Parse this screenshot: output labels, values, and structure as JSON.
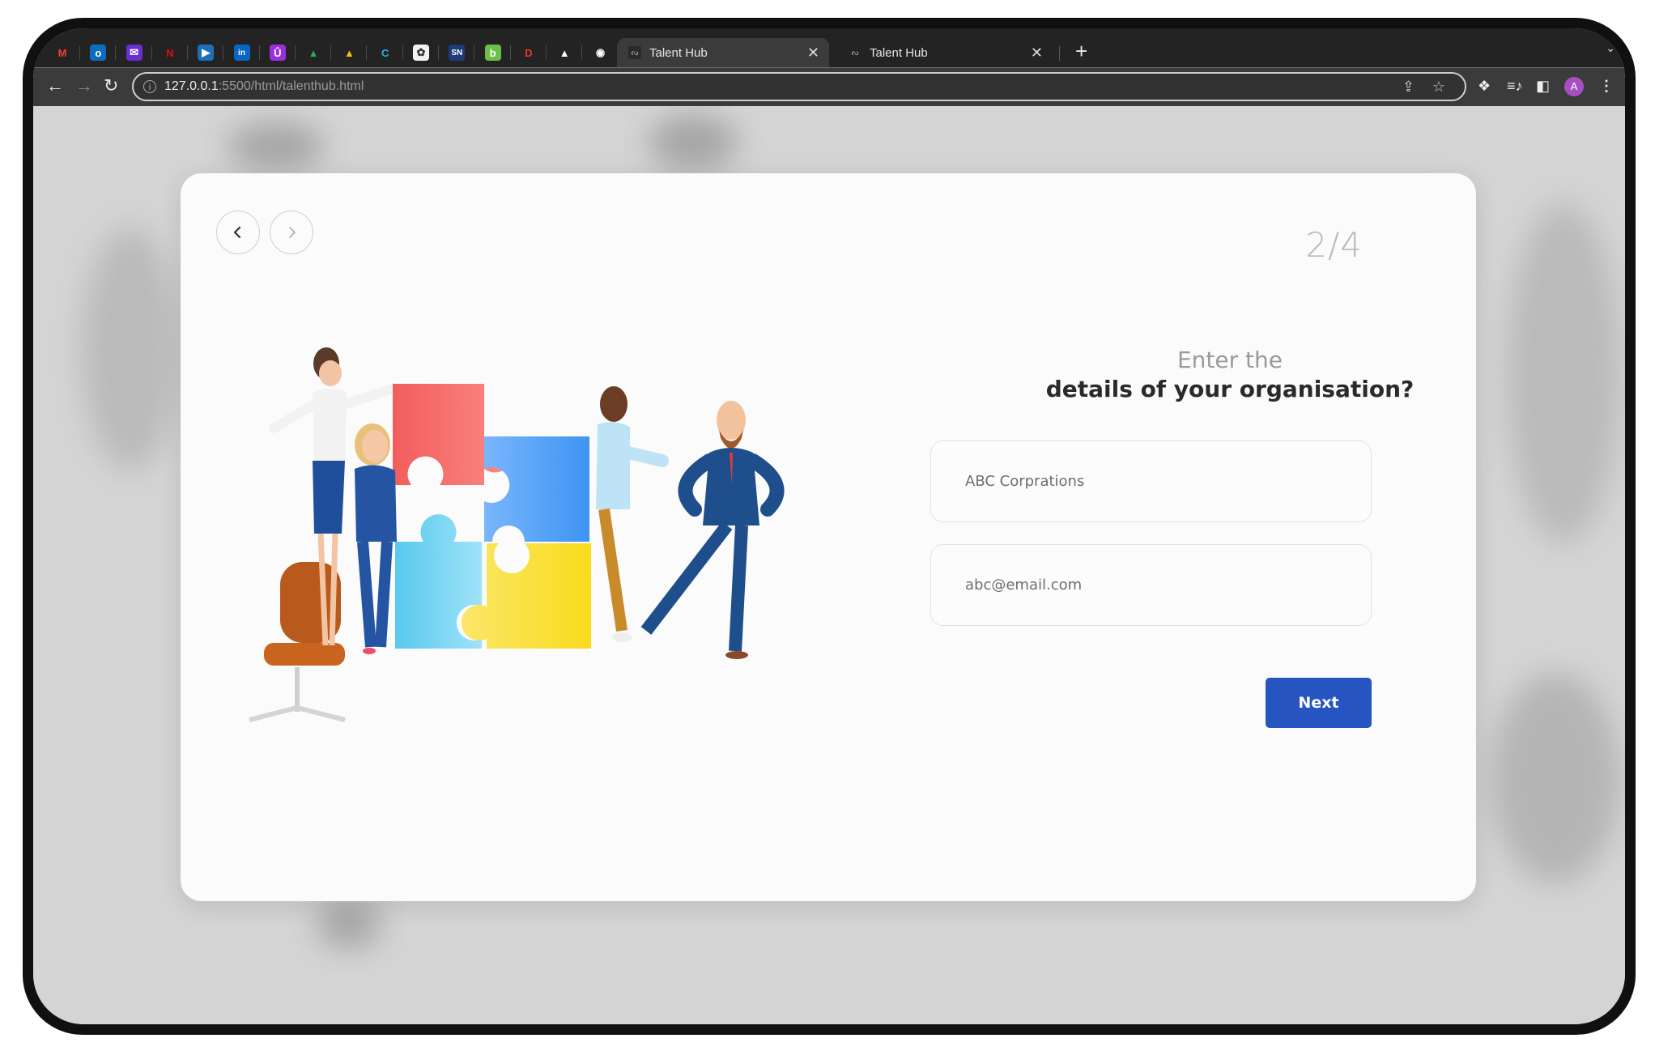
{
  "browser": {
    "pinned_tabs": [
      {
        "name": "gmail",
        "glyph": "M",
        "fg": "#ea4335",
        "bg": "transparent"
      },
      {
        "name": "outlook",
        "glyph": "o",
        "fg": "#ffffff",
        "bg": "#0f6cbd"
      },
      {
        "name": "mail",
        "glyph": "✉",
        "fg": "#ffffff",
        "bg": "#6b2fd1"
      },
      {
        "name": "netflix",
        "glyph": "N",
        "fg": "#e50914",
        "bg": "transparent"
      },
      {
        "name": "player",
        "glyph": "▶",
        "fg": "#ffffff",
        "bg": "#1d6fb8"
      },
      {
        "name": "linkedin",
        "glyph": "in",
        "fg": "#ffffff",
        "bg": "#0a66c2"
      },
      {
        "name": "u-app",
        "glyph": "Û",
        "fg": "#ffffff",
        "bg": "#9b2fe0"
      },
      {
        "name": "google-drive",
        "glyph": "▲",
        "fg": "#34a853",
        "bg": "transparent"
      },
      {
        "name": "google-drive",
        "glyph": "▲",
        "fg": "#fbbc04",
        "bg": "transparent"
      },
      {
        "name": "c-app",
        "glyph": "C",
        "fg": "#1fb6e8",
        "bg": "transparent"
      },
      {
        "name": "openai",
        "glyph": "✿",
        "fg": "#333333",
        "bg": "#f2f2f2"
      },
      {
        "name": "sn-app",
        "glyph": "SN",
        "fg": "#ffffff",
        "bg": "#1f3a78"
      },
      {
        "name": "b-app",
        "glyph": "b",
        "fg": "#ffffff",
        "bg": "#6cc04a"
      },
      {
        "name": "d-app",
        "glyph": "D",
        "fg": "#e53935",
        "bg": "transparent"
      },
      {
        "name": "triangle-app",
        "glyph": "▲",
        "fg": "#ffffff",
        "bg": "transparent"
      },
      {
        "name": "github",
        "glyph": "◉",
        "fg": "#ffffff",
        "bg": "transparent"
      }
    ],
    "tabs": [
      {
        "title": "Talent Hub",
        "active": true,
        "favicon": "ᔓ"
      },
      {
        "title": "Talent Hub",
        "active": false,
        "favicon": "ᔓ"
      }
    ],
    "new_tab": "+",
    "close_glyph": "✕",
    "tab_list_glyph": "⌄",
    "url_host": "127.0.0.1",
    "url_rest": ":5500/html/talenthub.html",
    "profile_initial": "A",
    "profile_color": "#a64fc1"
  },
  "page": {
    "step": "2/4",
    "question_line1": "Enter the",
    "question_line2": "details of your organisation?",
    "org_name_value": "ABC Corprations",
    "email_value": "abc@email.com",
    "next_label": "Next",
    "accent_color": "#2655c2"
  }
}
